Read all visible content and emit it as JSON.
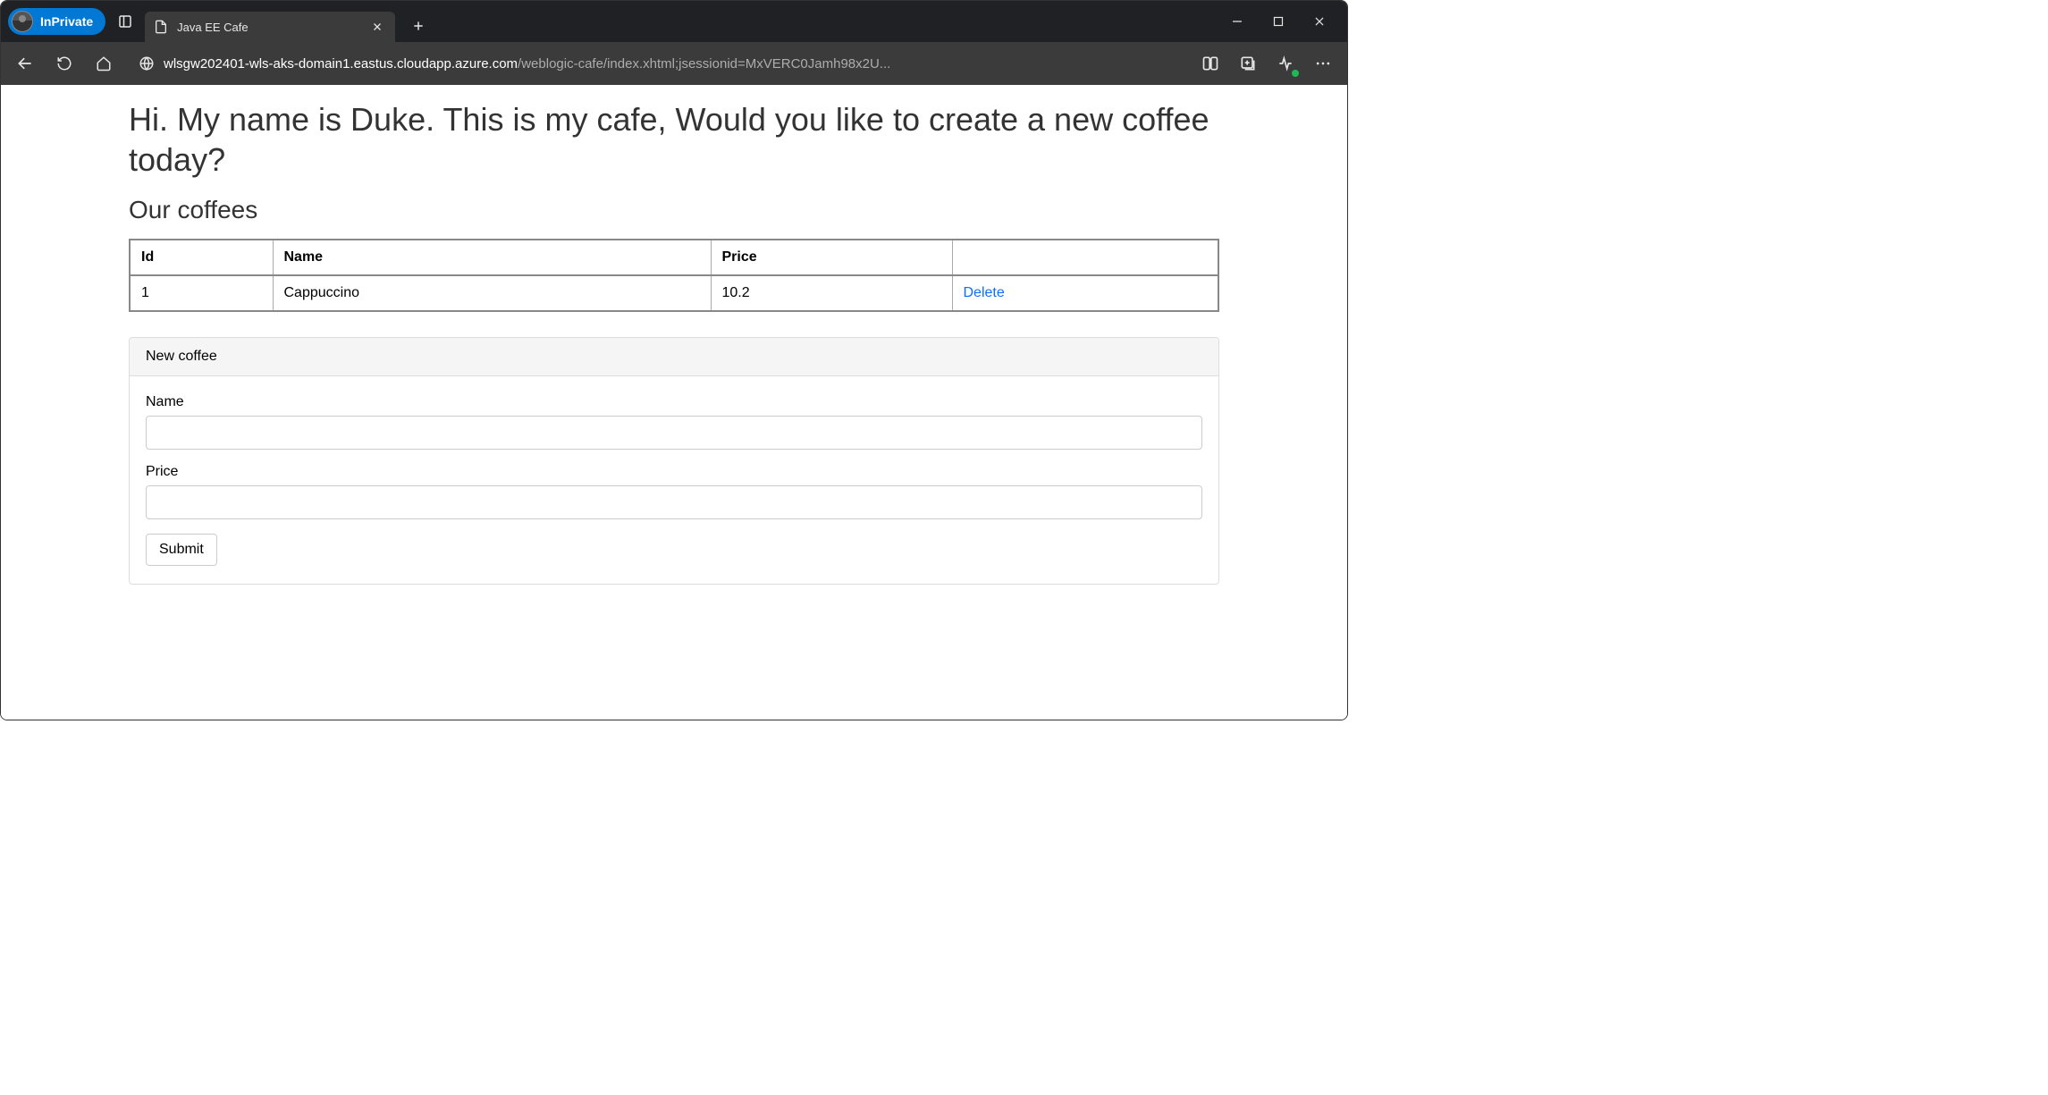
{
  "browser": {
    "inprivate_label": "InPrivate",
    "tab_title": "Java EE Cafe",
    "url_host": "wlsgw202401-wls-aks-domain1.eastus.cloudapp.azure.com",
    "url_path": "/weblogic-cafe/index.xhtml;jsessionid=MxVERC0Jamh98x2U..."
  },
  "page": {
    "heading": "Hi. My name is Duke. This is my cafe, Would you like to create a new coffee today?",
    "subheading": "Our coffees",
    "table": {
      "headers": {
        "id": "Id",
        "name": "Name",
        "price": "Price",
        "actions": ""
      },
      "rows": [
        {
          "id": "1",
          "name": "Cappuccino",
          "price": "10.2",
          "action": "Delete"
        }
      ]
    },
    "form": {
      "panel_title": "New coffee",
      "name_label": "Name",
      "name_value": "",
      "price_label": "Price",
      "price_value": "",
      "submit_label": "Submit"
    }
  }
}
